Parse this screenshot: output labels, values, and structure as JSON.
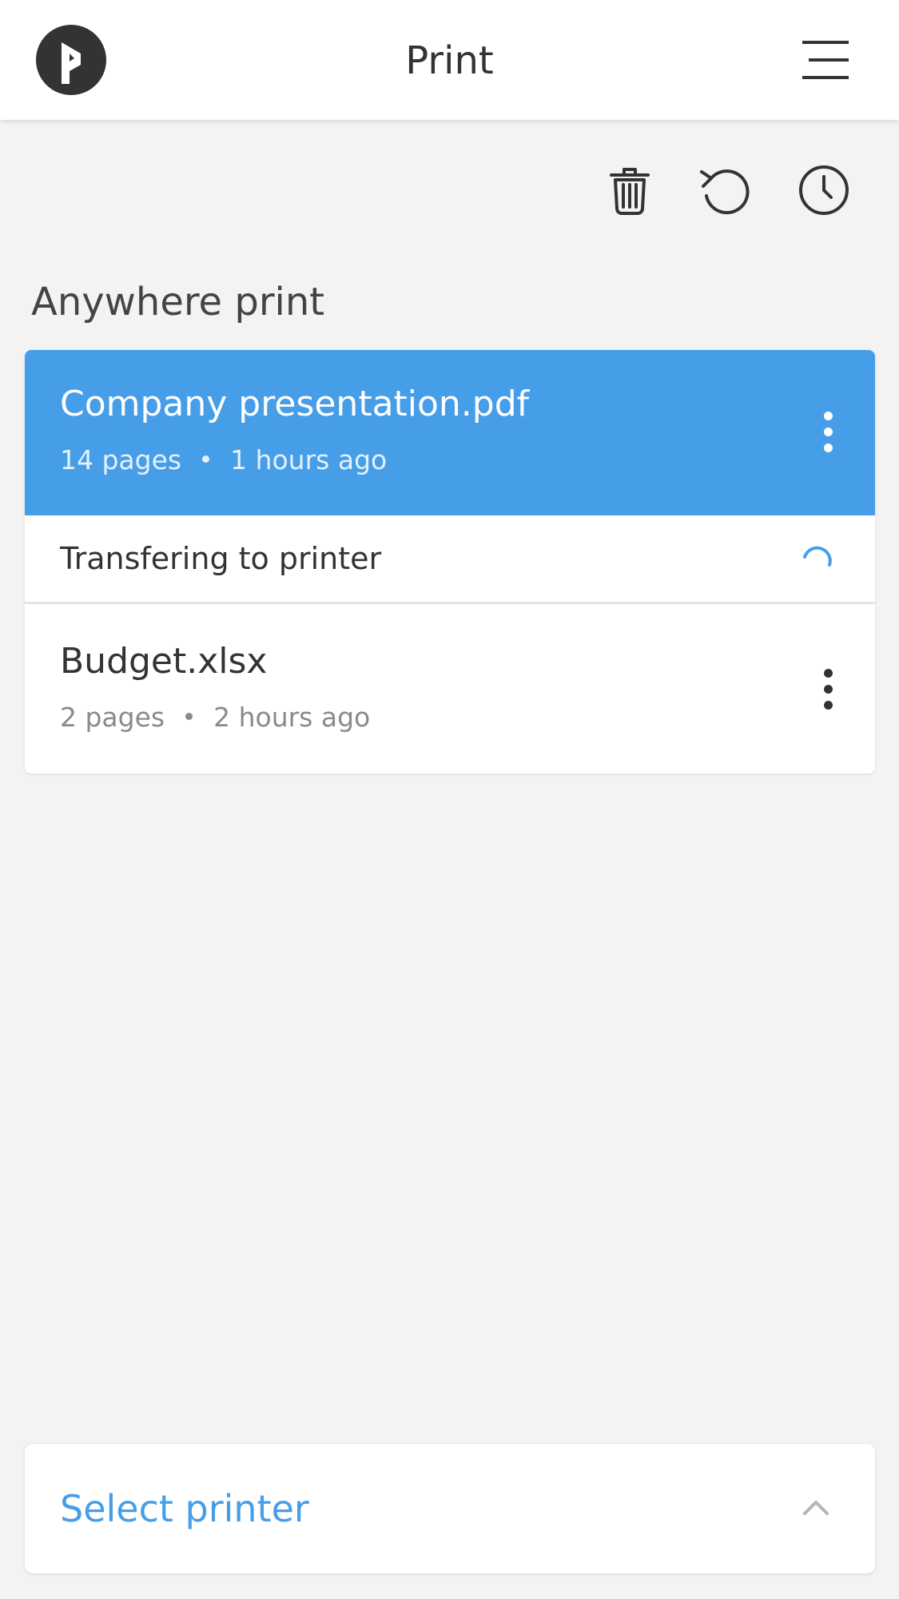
{
  "header": {
    "title": "Print"
  },
  "section_title": "Anywhere print",
  "jobs": [
    {
      "name": "Company presentation.pdf",
      "pages": "14 pages",
      "time": "1 hours ago",
      "status": "Transfering to printer"
    },
    {
      "name": "Budget.xlsx",
      "pages": "2 pages",
      "time": "2 hours ago"
    }
  ],
  "bottom": {
    "select_printer_label": "Select printer"
  },
  "icons": {
    "logo": "app-logo-icon",
    "menu": "hamburger-menu-icon",
    "delete": "trash-icon",
    "refresh": "refresh-icon",
    "history": "clock-icon",
    "more": "kebab-menu-icon",
    "loading": "spinner-icon",
    "expand": "chevron-up-icon"
  },
  "colors": {
    "accent": "#479ee8",
    "background": "#f3f3f3",
    "text": "#333333",
    "muted": "#8a8a8a"
  }
}
